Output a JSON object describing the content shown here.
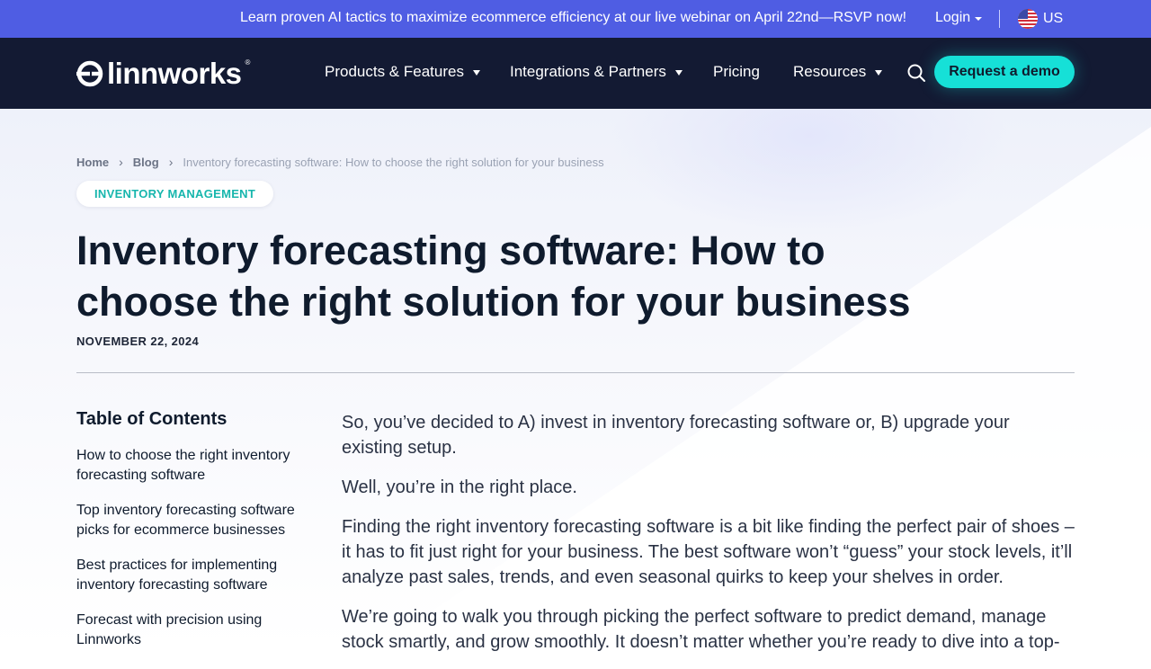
{
  "banner": {
    "message": "Learn proven AI tactics to maximize ecommerce efficiency at our live webinar on April 22nd—RSVP now!",
    "login_label": "Login",
    "region_label": "US"
  },
  "nav": {
    "logo_text": "linnworks",
    "logo_reg": "®",
    "items": [
      {
        "label": "Products & Features"
      },
      {
        "label": "Integrations & Partners"
      },
      {
        "label": "Pricing"
      },
      {
        "label": "Resources"
      }
    ],
    "cta_label": "Request a demo"
  },
  "breadcrumb": {
    "home": "Home",
    "blog": "Blog",
    "current": "Inventory forecasting software: How to choose the right solution for your business"
  },
  "article": {
    "tag": "INVENTORY MANAGEMENT",
    "title": "Inventory forecasting software: How to choose the right solution for your business",
    "date": "NOVEMBER 22, 2024",
    "paragraphs": [
      "So, you’ve decided to A) invest in inventory forecasting software or, B) upgrade your existing setup.",
      "Well, you’re in the right place.",
      "Finding the right inventory forecasting software is a bit like finding the perfect pair of shoes – it has to fit just right for your business. The best software won’t “guess” your stock levels, it’ll analyze past sales, trends, and even seasonal quirks to keep your shelves in order.",
      "We’re going to walk you through picking the perfect software to predict demand, manage stock smartly, and grow smoothly. It doesn’t matter whether you’re ready to dive into a top-"
    ]
  },
  "toc": {
    "title": "Table of Contents",
    "items": [
      "How to choose the right inventory forecasting software",
      "Top inventory forecasting software picks for ecommerce businesses",
      "Best practices for implementing inventory forecasting software",
      "Forecast with precision using Linnworks"
    ]
  },
  "colors": {
    "banner_bg": "#4f5de3",
    "nav_bg": "#131a33",
    "accent": "#16e0d7",
    "tag_text": "#17b6ad"
  },
  "icons": {
    "search": "search-icon",
    "flag": "us-flag-icon",
    "logo": "linnworks-logo-icon"
  }
}
